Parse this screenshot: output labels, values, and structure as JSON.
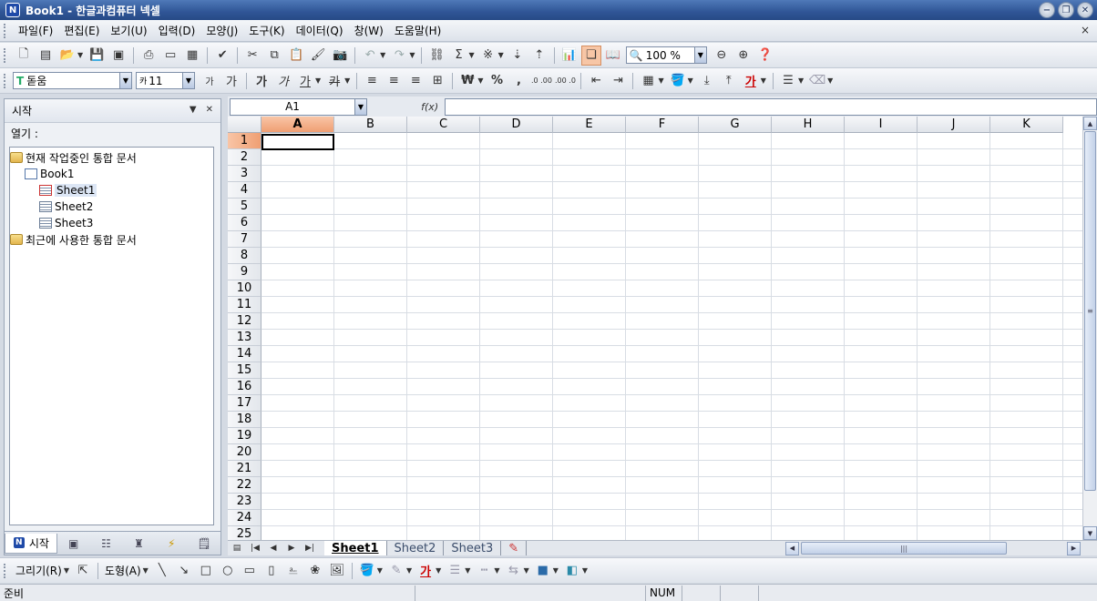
{
  "window": {
    "title": "Book1 - 한글과컴퓨터 넥셀",
    "app_icon_glyph": "N"
  },
  "menu": [
    "파일(F)",
    "편집(E)",
    "보기(U)",
    "입력(D)",
    "모양(J)",
    "도구(K)",
    "데이터(Q)",
    "창(W)",
    "도움말(H)"
  ],
  "menu_close": "×",
  "toolbar": {
    "zoom": "100 %",
    "font_name": "돋움",
    "font_size": "11",
    "font_size_prefix": "카",
    "font_icon_glyph": "T",
    "bold_glyph": "가",
    "italic_glyph": "가",
    "underline_glyph": "가",
    "strike_glyph": "카",
    "currency_glyph": "₩",
    "percent_glyph": "%",
    "comma_glyph": ",",
    "decimal_inc": ".0 .00",
    "decimal_dec": ".00 .0",
    "sum_glyph": "Σ",
    "font_color_glyph": "가",
    "shrink_font_glyph": "가",
    "grow_font_glyph": "가"
  },
  "left_pane": {
    "title": "시작",
    "open_label": "열기 :",
    "tree": [
      {
        "label": "현재 작업중인 통합 문서",
        "level": 0,
        "icon": "folder-icon"
      },
      {
        "label": "Book1",
        "level": 1,
        "icon": "workbook-icon"
      },
      {
        "label": "Sheet1",
        "level": 2,
        "icon": "sheet-icon",
        "selected": true
      },
      {
        "label": "Sheet2",
        "level": 2,
        "icon": "sheet-icon"
      },
      {
        "label": "Sheet3",
        "level": 2,
        "icon": "sheet-icon"
      },
      {
        "label": "최근에 사용한 통합 문서",
        "level": 0,
        "icon": "folder-icon"
      }
    ],
    "bottom_tab": "시작"
  },
  "formula_bar": {
    "name_box": "A1",
    "fx_label": "f(x)",
    "formula": ""
  },
  "sheet": {
    "columns": [
      "A",
      "B",
      "C",
      "D",
      "E",
      "F",
      "G",
      "H",
      "I",
      "J",
      "K"
    ],
    "rows": [
      "1",
      "2",
      "3",
      "4",
      "5",
      "6",
      "7",
      "8",
      "9",
      "10",
      "11",
      "12",
      "13",
      "14",
      "15",
      "16",
      "17",
      "18",
      "19",
      "20",
      "21",
      "22",
      "23",
      "24",
      "25"
    ],
    "selected_column": "A",
    "selected_row": "1"
  },
  "sheet_tabs": [
    "Sheet1",
    "Sheet2",
    "Sheet3"
  ],
  "active_sheet": "Sheet1",
  "drawbar": {
    "draw_label": "그리기(R)",
    "shape_label": "도형(A)",
    "font_color_glyph": "가"
  },
  "status": {
    "ready": "준비",
    "num": "NUM"
  },
  "colors": {
    "title_bar": "#2f5596",
    "selected_header": "#ef9f73",
    "toolbar_bg": "#dfe4eb"
  }
}
